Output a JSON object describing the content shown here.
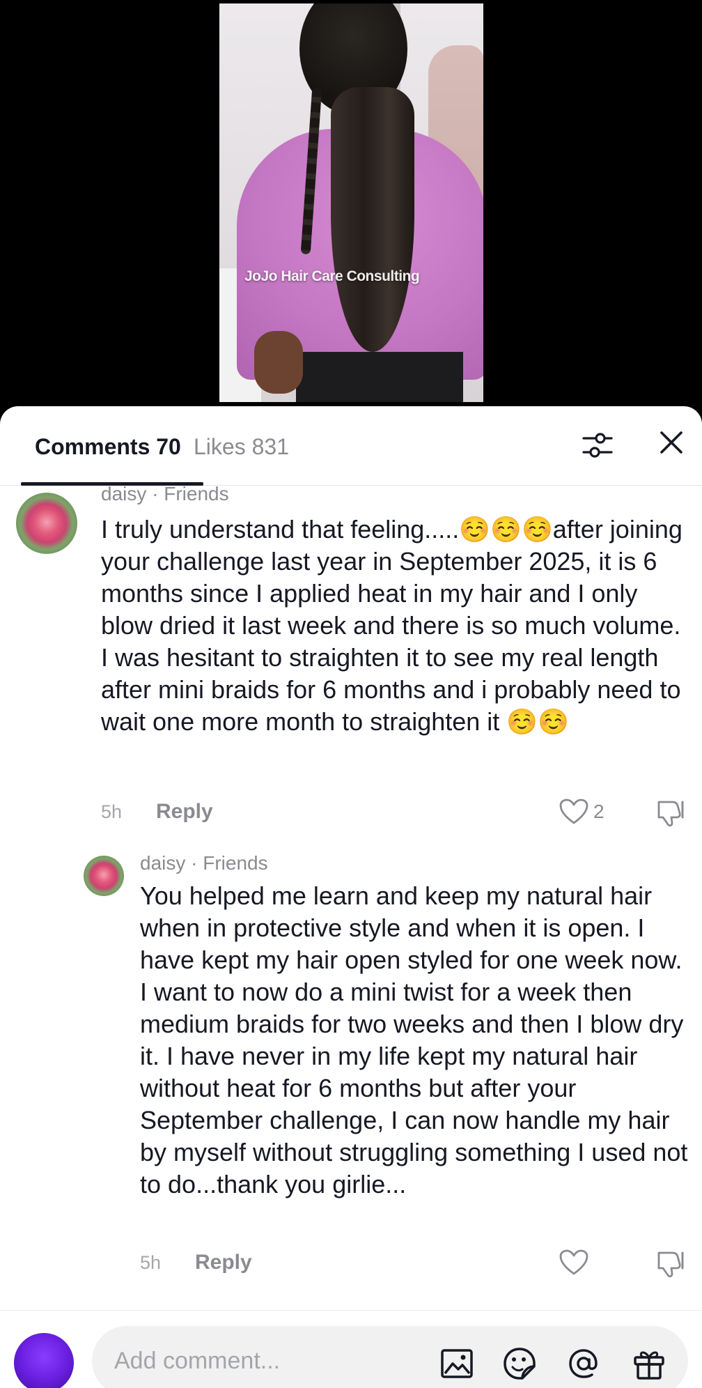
{
  "video": {
    "watermark": "JoJo Hair Care Consulting"
  },
  "tabs": {
    "comments_label": "Comments 70",
    "likes_label": "Likes 831"
  },
  "comments": [
    {
      "meta": "daisy · Friends",
      "text": "I truly understand that feeling.....☺️☺️☺️after joining your challenge last year in September 2025, it is 6 months since I applied heat in my hair and I only blow dried it last week and there is so much volume. I was hesitant to straighten it to see my real length after mini braids for 6 months and i probably need to wait one more month to straighten it ☺️☺️",
      "time": "5h",
      "reply_label": "Reply",
      "like_count": "2"
    },
    {
      "meta": "daisy · Friends",
      "text": "You helped me learn and keep my natural hair when in protective style and when it is open. I have kept my hair open styled for one week now. I want to now do a mini twist for a week then medium braids for two weeks and then I blow dry it. I have never in my life kept my natural hair without heat for 6 months but after your September challenge, I can now handle my hair by myself without struggling something I used not to do...thank you girlie...",
      "time": "5h",
      "reply_label": "Reply",
      "like_count": ""
    }
  ],
  "composer": {
    "placeholder": "Add comment..."
  },
  "icons": {
    "filter": "filter-icon",
    "close": "close-icon",
    "heart": "heart-icon",
    "dislike": "dislike-icon",
    "image": "image-icon",
    "sticker": "sticker-icon",
    "mention": "mention-icon",
    "gift": "gift-icon"
  }
}
